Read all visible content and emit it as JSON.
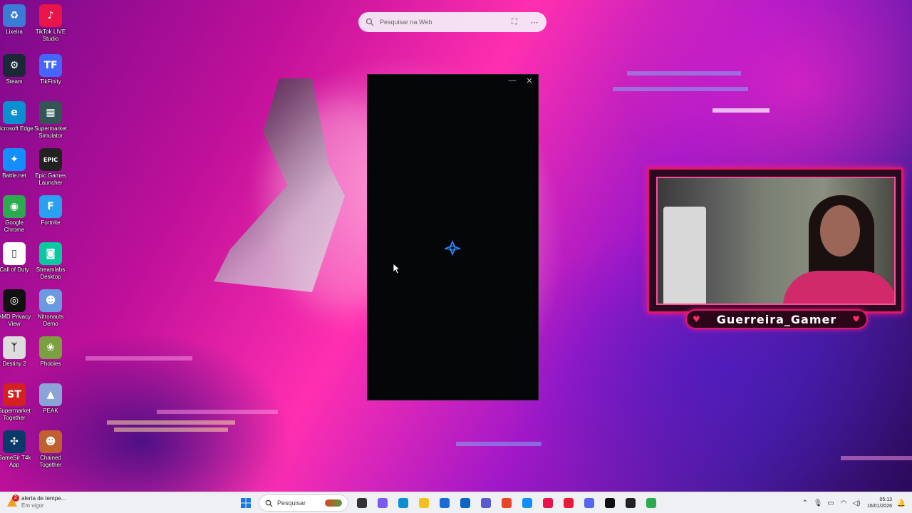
{
  "desktop": {
    "icons": [
      {
        "label": "Lixeira",
        "icon": "recycle-bin-icon",
        "glyph": "♻",
        "color": "#3a7bd5"
      },
      {
        "label": "TikTok LIVE Studio",
        "icon": "tiktok-live-icon",
        "glyph": "♪",
        "color": "#e8144a"
      },
      {
        "label": "Steam",
        "icon": "steam-icon",
        "glyph": "⚙",
        "color": "#1b2838"
      },
      {
        "label": "TikFinity",
        "icon": "tikfinity-icon",
        "glyph": "TF",
        "color": "#4466ff"
      },
      {
        "label": "Microsoft Edge",
        "icon": "edge-icon",
        "glyph": "e",
        "color": "#0c8fd0"
      },
      {
        "label": "Supermarket Simulator",
        "icon": "supermarket-simulator-icon",
        "glyph": "▦",
        "color": "#355"
      },
      {
        "label": "Battle.net",
        "icon": "battlenet-icon",
        "glyph": "✦",
        "color": "#148eff"
      },
      {
        "label": "Epic Games Launcher",
        "icon": "epic-games-icon",
        "glyph": "EPIC",
        "color": "#222"
      },
      {
        "label": "Google Chrome",
        "icon": "chrome-icon",
        "glyph": "◉",
        "color": "#2da94f"
      },
      {
        "label": "Fortnite",
        "icon": "fortnite-icon",
        "glyph": "F",
        "color": "#2aa0f0"
      },
      {
        "label": "Call of Duty",
        "icon": "document-icon",
        "glyph": "▯",
        "color": "#ffffff"
      },
      {
        "label": "Streamlabs Desktop",
        "icon": "streamlabs-icon",
        "glyph": "◙",
        "color": "#09c9a0"
      },
      {
        "label": "AMD Privacy View",
        "icon": "amd-privacy-view-icon",
        "glyph": "◎",
        "color": "#111"
      },
      {
        "label": "Nitronauts Demo",
        "icon": "nitronauts-icon",
        "glyph": "☻",
        "color": "#6a9adf"
      },
      {
        "label": "Destiny 2",
        "icon": "destiny-icon",
        "glyph": "ᛉ",
        "color": "#ddd"
      },
      {
        "label": "Phobies",
        "icon": "phobies-icon",
        "glyph": "❀",
        "color": "#7aa040"
      },
      {
        "label": "Supermarket Together",
        "icon": "supermarket-together-icon",
        "glyph": "ST",
        "color": "#d42020"
      },
      {
        "label": "PEAK",
        "icon": "peak-icon",
        "glyph": "▲",
        "color": "#8aa4d8"
      },
      {
        "label": "GameSir T4k App",
        "icon": "gamesir-icon",
        "glyph": "✣",
        "color": "#0a3a6a"
      },
      {
        "label": "Chained Together",
        "icon": "chained-together-icon",
        "glyph": "☻",
        "color": "#c06030"
      }
    ]
  },
  "websearch": {
    "placeholder": "Pesquisar na Web"
  },
  "loading_window": {
    "minimize": "—",
    "close": "✕"
  },
  "webcam": {
    "username": "Guerreira_Gamer"
  },
  "taskbar": {
    "weather": {
      "badge": "2",
      "title": "alerta de tempe...",
      "subtitle": "Em vigor"
    },
    "search_label": "Pesquisar",
    "apps": [
      {
        "name": "task-view-button",
        "color": "#333"
      },
      {
        "name": "copilot-button",
        "color": "#7a5af0"
      },
      {
        "name": "edge-taskbar-button",
        "color": "#0c8fd0"
      },
      {
        "name": "file-explorer-button",
        "color": "#f4c020"
      },
      {
        "name": "microsoft-store-button",
        "color": "#1a6ad8"
      },
      {
        "name": "outlook-button",
        "color": "#0a64c8"
      },
      {
        "name": "teams-button",
        "color": "#5a5ad0"
      },
      {
        "name": "google-app-button",
        "color": "#e8442a"
      },
      {
        "name": "battlenet-taskbar-button",
        "color": "#148eff"
      },
      {
        "name": "tiktok-live-taskbar-button",
        "color": "#e8144a"
      },
      {
        "name": "tikfinity-taskbar-button",
        "color": "#e81a3a"
      },
      {
        "name": "discord-button",
        "color": "#5865f2"
      },
      {
        "name": "call-of-duty-taskbar-button",
        "color": "#111"
      },
      {
        "name": "obs-button",
        "color": "#222"
      },
      {
        "name": "chrome-taskbar-button",
        "color": "#2da94f"
      }
    ],
    "clock": {
      "time": "05:13",
      "date": "16/01/2026"
    }
  }
}
